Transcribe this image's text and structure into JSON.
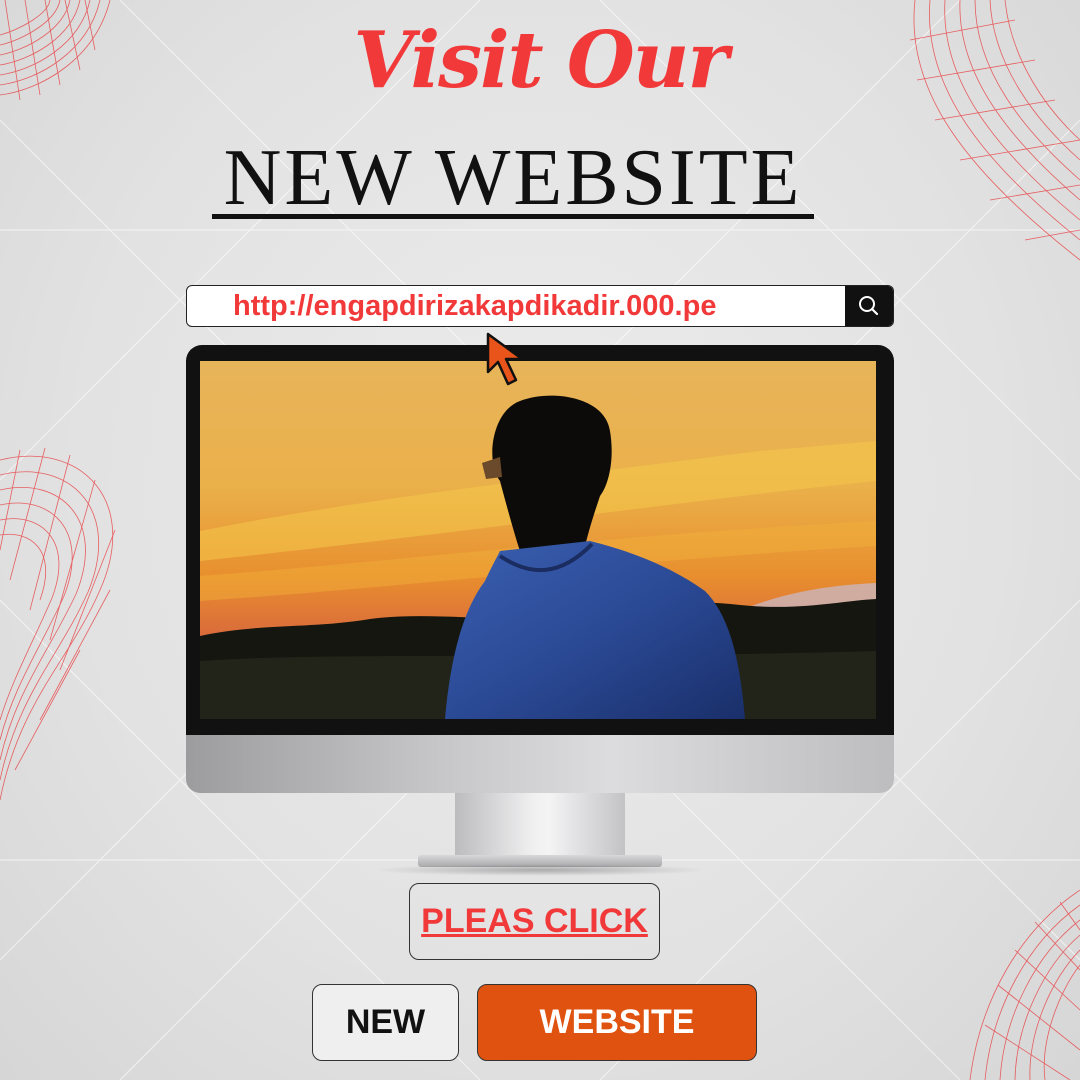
{
  "header": {
    "script_title": "Visit Our",
    "main_title": "NEW WEBSITE"
  },
  "address_bar": {
    "url": "http://engapdirizakapdikadir.000.pe",
    "search_icon": "search-icon"
  },
  "monitor": {
    "screen_image": "silhouette-of-man-at-sunset"
  },
  "buttons": {
    "pleas_click": "PLEAS CLICK",
    "new": "NEW",
    "website": "WEBSITE"
  },
  "colors": {
    "accent_red": "#f2393a",
    "website_button": "#e0520f",
    "background": "#e4e4e4",
    "ink": "#111111"
  },
  "icons": [
    "search-icon",
    "mouse-pointer-icon"
  ]
}
